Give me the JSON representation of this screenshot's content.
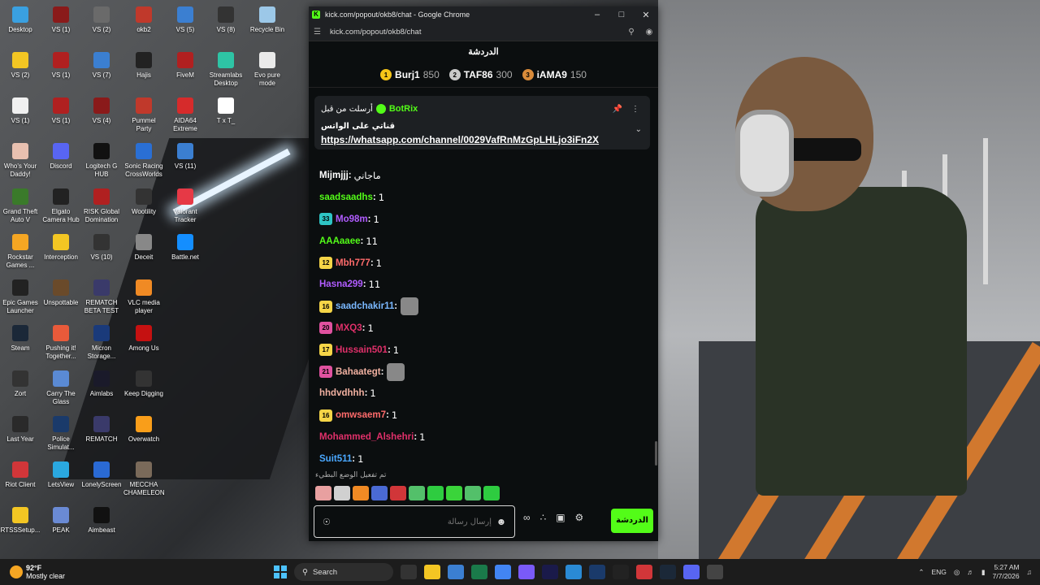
{
  "desktop_icons": [
    {
      "label": "Desktop",
      "color": "#3aa0e0"
    },
    {
      "label": "VS (1)",
      "color": "#8a1a1a"
    },
    {
      "label": "VS (2)",
      "color": "#6a6a6a"
    },
    {
      "label": "okb2",
      "color": "#c0392b"
    },
    {
      "label": "VS (5)",
      "color": "#3b7fd1"
    },
    {
      "label": "VS (8)",
      "color": "#333"
    },
    {
      "label": "Recycle Bin",
      "color": "#9cc8e8"
    },
    {
      "label": "VS (2)",
      "color": "#f3c623"
    },
    {
      "label": "VS (1)",
      "color": "#b02020"
    },
    {
      "label": "VS (7)",
      "color": "#3b7fd1"
    },
    {
      "label": "Hajis",
      "color": "#222"
    },
    {
      "label": "FiveM",
      "color": "#b02020"
    },
    {
      "label": "Streamlabs Desktop",
      "color": "#2ec4a5"
    },
    {
      "label": "Evo pure mode",
      "color": "#eaeaea"
    },
    {
      "label": "VS (1)",
      "color": "#f0f0f0"
    },
    {
      "label": "VS (1)",
      "color": "#b02020"
    },
    {
      "label": "VS (4)",
      "color": "#8a1a1a"
    },
    {
      "label": "Pummel Party",
      "color": "#c0392b"
    },
    {
      "label": "AIDA64 Extreme",
      "color": "#d62b2b"
    },
    {
      "label": "T x T_",
      "color": "#ffffff"
    },
    {
      "label": "Who's Your Daddy!",
      "color": "#e8c0b0"
    },
    {
      "label": "Discord",
      "color": "#5865f2"
    },
    {
      "label": "Logitech G HUB",
      "color": "#111"
    },
    {
      "label": "Sonic Racing CrossWorlds",
      "color": "#2a6fd4"
    },
    {
      "label": "VS (11)",
      "color": "#3b7fd1"
    },
    {
      "label": "Grand Theft Auto V",
      "color": "#3a7a2a"
    },
    {
      "label": "Elgato Camera Hub",
      "color": "#222"
    },
    {
      "label": "RISK Global Domination",
      "color": "#b02020"
    },
    {
      "label": "Wootility",
      "color": "#333"
    },
    {
      "label": "Valorant Tracker",
      "color": "#e63946"
    },
    {
      "label": "Rockstar Games ...",
      "color": "#f5a623"
    },
    {
      "label": "Interception",
      "color": "#f3c623"
    },
    {
      "label": "VS (10)",
      "color": "#333"
    },
    {
      "label": "Deceit",
      "color": "#888"
    },
    {
      "label": "Battle.net",
      "color": "#148eff"
    },
    {
      "label": "Epic Games Launcher",
      "color": "#222"
    },
    {
      "label": "Unspottable",
      "color": "#6a4a2a"
    },
    {
      "label": "REMATCH BETA TEST",
      "color": "#3a3a6a"
    },
    {
      "label": "VLC media player",
      "color": "#f08a24"
    },
    {
      "label": "Steam",
      "color": "#1b2838"
    },
    {
      "label": "Pushing it! Together...",
      "color": "#e85a3a"
    },
    {
      "label": "Micron Storage...",
      "color": "#1a3a7a"
    },
    {
      "label": "Among Us",
      "color": "#c51111"
    },
    {
      "label": "Zort",
      "color": "#333"
    },
    {
      "label": "Carry The Glass",
      "color": "#5a8ad4"
    },
    {
      "label": "Aimlabs",
      "color": "#1a1a2a"
    },
    {
      "label": "Keep Digging",
      "color": "#333"
    },
    {
      "label": "Last Year",
      "color": "#2a2a2a"
    },
    {
      "label": "Police Simulat...",
      "color": "#1a3a6a"
    },
    {
      "label": "REMATCH",
      "color": "#3a3a6a"
    },
    {
      "label": "Overwatch",
      "color": "#f99e1a"
    },
    {
      "label": "Riot Client",
      "color": "#d13639"
    },
    {
      "label": "LetsView",
      "color": "#2aa8e0"
    },
    {
      "label": "LonelyScreen",
      "color": "#2a6ad4"
    },
    {
      "label": "MECCHA CHAMELEON",
      "color": "#7a6a5a"
    },
    {
      "label": "RTSSSetup...",
      "color": "#f3c623"
    },
    {
      "label": "PEAK",
      "color": "#6a8ad4"
    },
    {
      "label": "Aimbeast",
      "color": "#111"
    }
  ],
  "browser": {
    "title": "kick.com/popout/okb8/chat - Google Chrome",
    "url": "kick.com/popout/okb8/chat",
    "favicon": "K"
  },
  "chat": {
    "header": "الدردشة",
    "leaderboard": [
      {
        "rank": "1",
        "name": "Burj1",
        "points": "850",
        "color": "#f5c518"
      },
      {
        "rank": "2",
        "name": "TAF86",
        "points": "300",
        "color": "#c9c9c9"
      },
      {
        "rank": "3",
        "name": "iAMA9",
        "points": "150",
        "color": "#d98b3a"
      }
    ],
    "pinned": {
      "author": "BotRix",
      "pinned_by": "أرسلت من قبل",
      "text": "قناتي على الواتس",
      "link": "https://whatsapp.com/channel/0029VafRnMzGpLHLjo3iFn2X"
    },
    "messages": [
      {
        "badge": "",
        "badge_color": "",
        "user": "Mijmjjj",
        "user_color": "#ffffff",
        "text": "ماجاني",
        "emote": false
      },
      {
        "badge": "",
        "badge_color": "",
        "user": "saadsaadhs",
        "user_color": "#53fc18",
        "text": "1",
        "emote": false
      },
      {
        "badge": "33",
        "badge_color": "#2ec4c4",
        "user": "Mo98m",
        "user_color": "#b15cff",
        "text": "1",
        "emote": false
      },
      {
        "badge": "",
        "badge_color": "",
        "user": "AAAaaee",
        "user_color": "#53fc18",
        "text": "11",
        "emote": false
      },
      {
        "badge": "12",
        "badge_color": "#f5d547",
        "user": "Mbh777",
        "user_color": "#ff6b6b",
        "text": "1",
        "emote": false
      },
      {
        "badge": "",
        "badge_color": "",
        "user": "Hasna299",
        "user_color": "#b15cff",
        "text": "11",
        "emote": false
      },
      {
        "badge": "16",
        "badge_color": "#f5d547",
        "user": "saadchakir11",
        "user_color": "#7ab8ff",
        "text": "",
        "emote": true
      },
      {
        "badge": "20",
        "badge_color": "#e052a0",
        "user": "MXQ3",
        "user_color": "#e0306a",
        "text": "1",
        "emote": false
      },
      {
        "badge": "17",
        "badge_color": "#f5d547",
        "user": "Hussain501",
        "user_color": "#e0306a",
        "text": "1",
        "emote": false
      },
      {
        "badge": "21",
        "badge_color": "#e052a0",
        "user": "Bahaategt",
        "user_color": "#f0b0a0",
        "text": "",
        "emote": true
      },
      {
        "badge": "",
        "badge_color": "",
        "user": "hhdvdhhh",
        "user_color": "#f0b0a0",
        "text": "1",
        "emote": false
      },
      {
        "badge": "16",
        "badge_color": "#f5d547",
        "user": "omwsaem7",
        "user_color": "#ff6b6b",
        "text": "1",
        "emote": false
      },
      {
        "badge": "",
        "badge_color": "",
        "user": "Mohammed_Alshehri",
        "user_color": "#e0306a",
        "text": "1",
        "emote": false
      },
      {
        "badge": "",
        "badge_color": "",
        "user": "Suit511",
        "user_color": "#4aa8ff",
        "text": "1",
        "emote": false
      }
    ],
    "slow_mode": "تم تفعيل الوضع البطيء",
    "emote_colors": [
      "#e8a0a0",
      "#d0d0d0",
      "#f08a24",
      "#4a6ad4",
      "#d13639",
      "#53c06a",
      "#2ecc40",
      "#3ad43a",
      "#53c06a",
      "#2ecc40"
    ],
    "input_placeholder": "إرسال رسالة",
    "send_label": "الدردشة"
  },
  "taskbar": {
    "temp": "92°F",
    "weather": "Mostly clear",
    "search": "Search",
    "lang": "ENG",
    "time": "5:27 AM",
    "date": "7/7/2026",
    "app_colors": [
      "#333",
      "#f3c623",
      "#3b7fd1",
      "#1a7a4a",
      "#4285f4",
      "#7a5af8",
      "#1a1a4a",
      "#2a8ad4",
      "#1a3a6a",
      "#222",
      "#d13639",
      "#1b2838",
      "#5865f2",
      "#444"
    ]
  }
}
